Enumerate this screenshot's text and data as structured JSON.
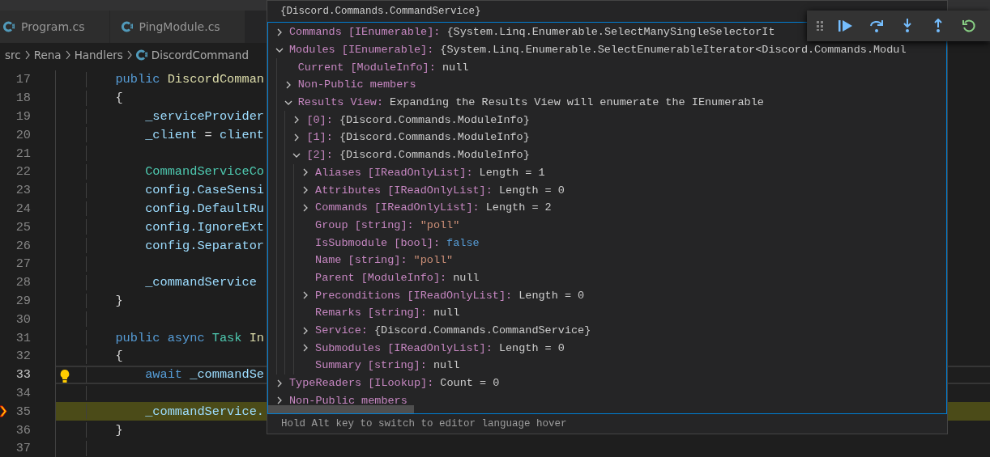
{
  "tabs": [
    {
      "label": "Program.cs",
      "selected": false
    },
    {
      "label": "PingModule.cs",
      "selected": false
    }
  ],
  "breadcrumbs": [
    {
      "label": "src",
      "kind": "folder"
    },
    {
      "label": "Rena",
      "kind": "folder"
    },
    {
      "label": "Handlers",
      "kind": "folder"
    },
    {
      "label": "DiscordCommand",
      "kind": "file"
    }
  ],
  "editor": {
    "lines": [
      {
        "number": "17",
        "kind": "member",
        "cursor": false,
        "paused": false,
        "lightbulb": false,
        "tokens": [
          {
            "text": "public ",
            "kind": "keyword"
          },
          {
            "text": "DiscordComman",
            "kind": "method"
          }
        ]
      },
      {
        "number": "18",
        "kind": "member",
        "cursor": false,
        "paused": false,
        "lightbulb": false,
        "tokens": [
          {
            "text": "{",
            "kind": "plain"
          }
        ]
      },
      {
        "number": "19",
        "kind": "statement",
        "cursor": false,
        "paused": false,
        "lightbulb": false,
        "tokens": [
          {
            "text": "_serviceProvider",
            "kind": "variable"
          }
        ]
      },
      {
        "number": "20",
        "kind": "statement",
        "cursor": false,
        "paused": false,
        "lightbulb": false,
        "tokens": [
          {
            "text": "_client",
            "kind": "variable"
          },
          {
            "text": " = ",
            "kind": "plain"
          },
          {
            "text": "client",
            "kind": "variable"
          }
        ]
      },
      {
        "number": "21",
        "cursor": false,
        "paused": false,
        "lightbulb": false
      },
      {
        "number": "22",
        "kind": "statement",
        "cursor": false,
        "paused": false,
        "lightbulb": false,
        "tokens": [
          {
            "text": "CommandServiceCo",
            "kind": "type"
          }
        ]
      },
      {
        "number": "23",
        "kind": "statement",
        "cursor": false,
        "paused": false,
        "lightbulb": false,
        "tokens": [
          {
            "text": "config.CaseSensi",
            "kind": "variable"
          }
        ]
      },
      {
        "number": "24",
        "kind": "statement",
        "cursor": false,
        "paused": false,
        "lightbulb": false,
        "tokens": [
          {
            "text": "config.DefaultRu",
            "kind": "variable"
          }
        ]
      },
      {
        "number": "25",
        "kind": "statement",
        "cursor": false,
        "paused": false,
        "lightbulb": false,
        "tokens": [
          {
            "text": "config.IgnoreExt",
            "kind": "variable"
          }
        ]
      },
      {
        "number": "26",
        "kind": "statement",
        "cursor": false,
        "paused": false,
        "lightbulb": false,
        "tokens": [
          {
            "text": "config.Separator",
            "kind": "variable"
          }
        ]
      },
      {
        "number": "27",
        "cursor": false,
        "paused": false,
        "lightbulb": false
      },
      {
        "number": "28",
        "kind": "statement",
        "cursor": false,
        "paused": false,
        "lightbulb": false,
        "tokens": [
          {
            "text": "_commandService",
            "kind": "variable"
          }
        ]
      },
      {
        "number": "29",
        "kind": "member",
        "cursor": false,
        "paused": false,
        "lightbulb": false,
        "tokens": [
          {
            "text": "}",
            "kind": "plain"
          }
        ]
      },
      {
        "number": "30",
        "cursor": false,
        "paused": false,
        "lightbulb": false
      },
      {
        "number": "31",
        "kind": "member",
        "cursor": false,
        "paused": false,
        "lightbulb": false,
        "tokens": [
          {
            "text": "public async ",
            "kind": "keyword"
          },
          {
            "text": "Task ",
            "kind": "type"
          },
          {
            "text": "In",
            "kind": "method"
          }
        ]
      },
      {
        "number": "32",
        "kind": "member",
        "cursor": false,
        "paused": false,
        "lightbulb": false,
        "tokens": [
          {
            "text": "{",
            "kind": "plain"
          }
        ]
      },
      {
        "number": "33",
        "kind": "statement",
        "cursor": true,
        "paused": false,
        "lightbulb": true,
        "tokens": [
          {
            "text": "await ",
            "kind": "keyword"
          },
          {
            "text": "_commandSe",
            "kind": "variable"
          }
        ]
      },
      {
        "number": "34",
        "cursor": false,
        "paused": false,
        "lightbulb": false
      },
      {
        "number": "35",
        "kind": "statement",
        "cursor": false,
        "paused": true,
        "lightbulb": false,
        "tokens": [
          {
            "text": "_commandService.",
            "kind": "variable"
          }
        ]
      },
      {
        "number": "36",
        "kind": "member",
        "cursor": false,
        "paused": false,
        "lightbulb": false,
        "tokens": [
          {
            "text": "}",
            "kind": "plain"
          }
        ]
      },
      {
        "number": "37",
        "cursor": false,
        "paused": false,
        "lightbulb": false
      }
    ]
  },
  "hover": {
    "title": "{Discord.Commands.CommandService}",
    "items": [
      {
        "label": "Commands [IEnumerable]:",
        "value": "{System.Linq.Enumerable.SelectManySingleSelectorIt",
        "kind": "plain",
        "expanded": false
      },
      {
        "label": "Modules [IEnumerable]:",
        "value": "{System.Linq.Enumerable.SelectEnumerableIterator<Discord.Commands.Modul",
        "kind": "plain",
        "expanded": true,
        "children": [
          {
            "label": "Current [ModuleInfo]:",
            "value": "null",
            "kind": "plain"
          },
          {
            "label": "Non-Public members",
            "expanded": false
          },
          {
            "label": "Results View:",
            "value": "Expanding the Results View will enumerate the IEnumerable",
            "kind": "plain",
            "expanded": true,
            "children": [
              {
                "label": "[0]:",
                "value": "{Discord.Commands.ModuleInfo}",
                "kind": "plain",
                "expanded": false
              },
              {
                "label": "[1]:",
                "value": "{Discord.Commands.ModuleInfo}",
                "kind": "plain",
                "expanded": false
              },
              {
                "label": "[2]:",
                "value": "{Discord.Commands.ModuleInfo}",
                "kind": "plain",
                "expanded": true,
                "children": [
                  {
                    "label": "Aliases [IReadOnlyList]:",
                    "value": "Length = 1",
                    "kind": "plain",
                    "expanded": false
                  },
                  {
                    "label": "Attributes [IReadOnlyList]:",
                    "value": "Length = 0",
                    "kind": "plain",
                    "expanded": false
                  },
                  {
                    "label": "Commands [IReadOnlyList]:",
                    "value": "Length = 2",
                    "kind": "plain",
                    "expanded": false
                  },
                  {
                    "label": "Group [string]:",
                    "value": "\"poll\"",
                    "kind": "string"
                  },
                  {
                    "label": "IsSubmodule [bool]:",
                    "value": "false",
                    "kind": "keyword"
                  },
                  {
                    "label": "Name [string]:",
                    "value": "\"poll\"",
                    "kind": "string"
                  },
                  {
                    "label": "Parent [ModuleInfo]:",
                    "value": "null",
                    "kind": "plain"
                  },
                  {
                    "label": "Preconditions [IReadOnlyList]:",
                    "value": "Length = 0",
                    "kind": "plain",
                    "expanded": false
                  },
                  {
                    "label": "Remarks [string]:",
                    "value": "null",
                    "kind": "plain"
                  },
                  {
                    "label": "Service:",
                    "value": "{Discord.Commands.CommandService}",
                    "kind": "plain",
                    "expanded": false
                  },
                  {
                    "label": "Submodules [IReadOnlyList]:",
                    "value": "Length = 0",
                    "kind": "plain",
                    "expanded": false
                  },
                  {
                    "label": "Summary [string]:",
                    "value": "null",
                    "kind": "plain"
                  }
                ]
              }
            ]
          }
        ]
      },
      {
        "label": "TypeReaders [ILookup]:",
        "value": "Count = 0",
        "kind": "plain",
        "expanded": false
      },
      {
        "label": "Non-Public members",
        "expanded": false
      }
    ],
    "footer": "Hold Alt key to switch to editor language hover"
  },
  "debug_toolbar": [
    {
      "kind": "continue"
    },
    {
      "kind": "step-over"
    },
    {
      "kind": "step-into"
    },
    {
      "kind": "step-out"
    },
    {
      "kind": "restart"
    }
  ]
}
